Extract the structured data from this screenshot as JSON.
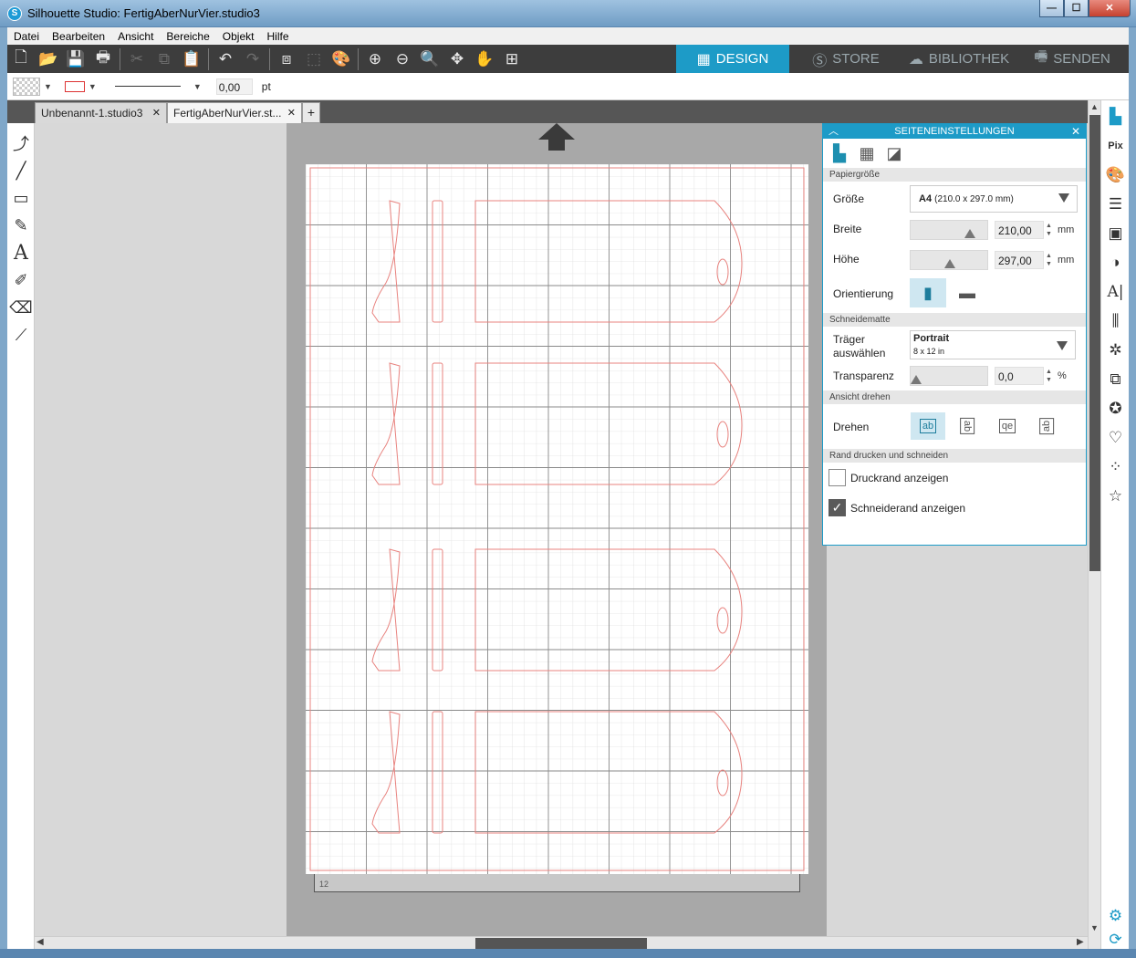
{
  "window": {
    "title": "Silhouette Studio: FertigAberNurVier.studio3",
    "app_icon": "S",
    "buttons": {
      "minimize": "—",
      "maximize": "☐",
      "close": "✕"
    }
  },
  "menu": [
    "Datei",
    "Bearbeiten",
    "Ansicht",
    "Bereiche",
    "Objekt",
    "Hilfe"
  ],
  "toolbar": {
    "icons": [
      "new-doc-icon",
      "open-folder-icon",
      "save-icon",
      "print-icon",
      "cut-icon",
      "copy-icon",
      "paste-icon",
      "undo-icon",
      "redo-icon",
      "group-icon",
      "ungroup-icon",
      "color-palette-icon",
      "zoom-in-icon",
      "zoom-out-icon",
      "zoom-fit-icon",
      "move-arrows-icon",
      "pan-hand-icon",
      "fit-page-icon"
    ],
    "nav_tabs": [
      {
        "label": "DESIGN",
        "icon": "grid-icon",
        "active": true
      },
      {
        "label": "STORE",
        "icon": "silhouette-s-icon",
        "active": false
      },
      {
        "label": "BIBLIOTHEK",
        "icon": "cloud-icon",
        "active": false
      },
      {
        "label": "SENDEN",
        "icon": "cutter-icon",
        "active": false
      }
    ]
  },
  "propbar": {
    "line_width": "0,00",
    "unit": "pt"
  },
  "doc_tabs": [
    {
      "label": "Unbenannt-1.studio3",
      "close": "✕"
    },
    {
      "label": "FertigAberNurVier.st...",
      "close": "✕"
    }
  ],
  "add_tab": "+",
  "ruler_label": "12",
  "panel": {
    "title": "SEITENEINSTELLUNGEN",
    "collapse": "︿",
    "close": "✕",
    "sections": {
      "paper": "Papiergröße",
      "mat": "Schneidematte",
      "rotate": "Ansicht drehen",
      "border": "Rand drucken und schneiden"
    },
    "size_label": "Größe",
    "size_value_bold": "A4",
    "size_value_detail": "(210.0 x 297.0 mm)",
    "width_label": "Breite",
    "width_value": "210,00",
    "width_unit": "mm",
    "width_slider": 0.82,
    "height_label": "Höhe",
    "height_value": "297,00",
    "height_unit": "mm",
    "height_slider": 0.52,
    "orientation_label": "Orientierung",
    "carrier_label_1": "Träger",
    "carrier_label_2": "auswählen",
    "carrier_value": "Portrait",
    "carrier_detail": "8 x 12 in",
    "transparency_label": "Transparenz",
    "transparency_value": "0,0",
    "transparency_unit": "%",
    "transparency_slider": 0.0,
    "rotate_label": "Drehen",
    "rotate_options": [
      "ab",
      "ab",
      "qe",
      "ab"
    ],
    "print_border_label": "Druckrand anzeigen",
    "print_border_checked": false,
    "cut_border_label": "Schneiderand anzeigen",
    "cut_border_checked": true
  },
  "colors": {
    "accent": "#1d9bc7",
    "cut_line": "#e8837f",
    "toolbar_bg": "#3d3d3d"
  }
}
